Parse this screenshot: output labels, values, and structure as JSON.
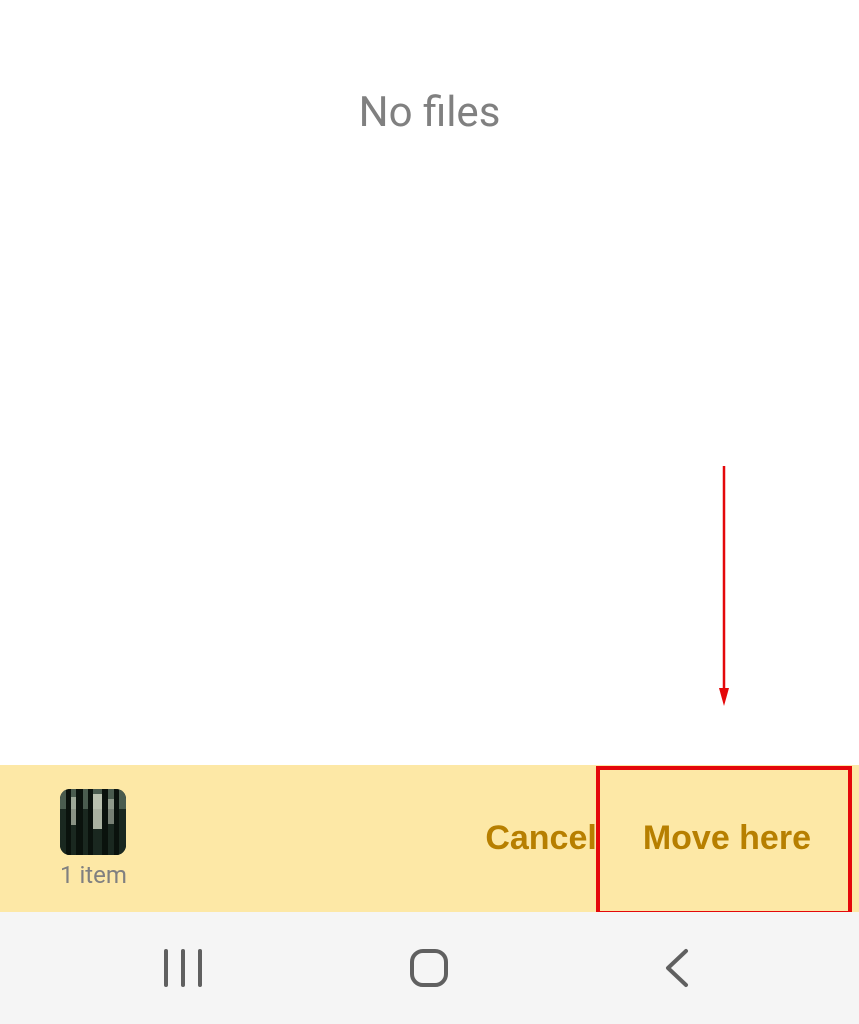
{
  "empty_state": {
    "message": "No files"
  },
  "action_bar": {
    "item_count_label": "1 item",
    "cancel_label": "Cancel",
    "move_label": "Move here"
  },
  "colors": {
    "accent": "#b77f00",
    "action_bar_bg": "#fde8a6",
    "highlight": "#e4080a"
  }
}
